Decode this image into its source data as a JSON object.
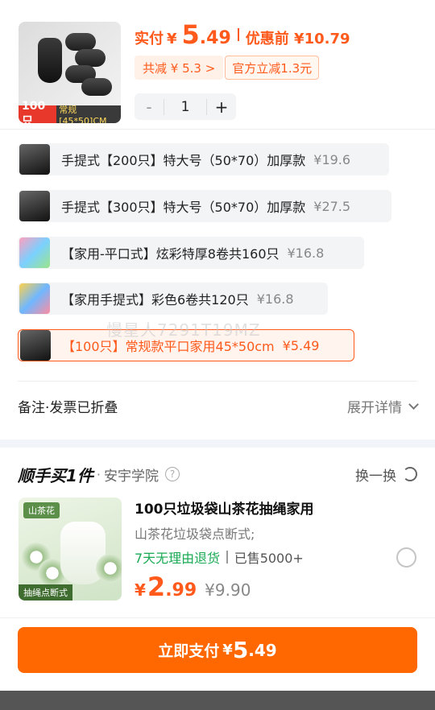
{
  "product": {
    "thumb_qty": "100只",
    "thumb_spec": "常规[45*50]CM",
    "pay_label": "实付",
    "currency": "¥",
    "pay_int": "5",
    "pay_dec": ".49",
    "before_label": "优惠前 ¥10.79",
    "discount_total": "共减 ¥ 5.3 >",
    "discount_official": "官方立减1.3元",
    "quantity": "1",
    "minus": "-",
    "plus": "+"
  },
  "options": [
    {
      "name": "手提式【200只】特大号（50*70）加厚款",
      "price": "¥19.6",
      "image": "black-bags",
      "selected": false
    },
    {
      "name": "手提式【300只】特大号（50*70）加厚款",
      "price": "¥27.5",
      "image": "black-bags",
      "selected": false
    },
    {
      "name": "【家用-平口式】炫彩特厚8卷共160只",
      "price": "¥16.8",
      "image": "color-rolls",
      "selected": false
    },
    {
      "name": "【家用手提式】彩色6卷共120只",
      "price": "¥16.8",
      "image": "color-rolls",
      "selected": false
    },
    {
      "name": "【100只】常规款平口家用45*50cm",
      "price": "¥5.49",
      "image": "black-bags",
      "selected": true
    }
  ],
  "watermark": "慢星人7291T19MZ",
  "remark": {
    "label": "备注·发票已折叠",
    "expand": "展开详情"
  },
  "recommend": {
    "title": "顺手买1件",
    "dot": "·",
    "source": "安宇学院",
    "help": "?",
    "swap": "换一换",
    "image_badge": "山茶花",
    "image_tag": "抽绳点断式",
    "name": "100只垃圾袋山茶花抽绳家用",
    "desc": "山茶花垃圾袋点断式;",
    "tag_return": "7天无理由退货",
    "tag_sold": "已售5000+",
    "currency": "¥",
    "price_int": "2",
    "price_dec": ".99",
    "orig_price": "¥9.90"
  },
  "pay_button": {
    "label": "立即支付",
    "currency": "¥",
    "int": "5",
    "dec": ".49"
  },
  "colors": {
    "accent": "#ff6700",
    "price": "#ff5a1c",
    "green": "#1aaa55"
  }
}
